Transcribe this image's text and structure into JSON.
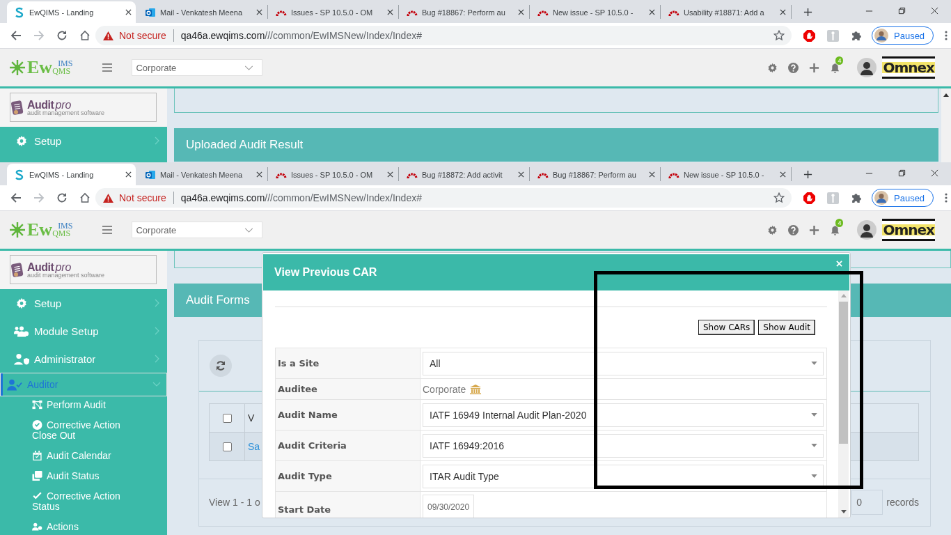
{
  "screens": [
    {
      "browser": {
        "tabs": [
          {
            "title": "EwQIMS - Landing",
            "kind": "ewqims",
            "selected": true
          },
          {
            "title": "Mail - Venkatesh Meena",
            "kind": "outlook",
            "selected": false
          },
          {
            "title": "Issues - SP 10.5.0 - OM",
            "kind": "redmine",
            "selected": false
          },
          {
            "title": "Bug #18867: Perform au",
            "kind": "redmine",
            "selected": false
          },
          {
            "title": "New issue - SP 10.5.0 -",
            "kind": "redmine",
            "selected": false
          },
          {
            "title": "Usability #18871: Add a",
            "kind": "redmine",
            "selected": false
          }
        ],
        "warning": "Not secure",
        "url_host": "qa46a.ewqims.com",
        "url_path": "///common/EwIMSNew/Index/Index#",
        "profile_status": "Paused"
      },
      "header": {
        "logo": {
          "main": "Ew",
          "top": "IMS",
          "bottom": "QMS"
        },
        "site": "Corporate",
        "notifications": "4",
        "company": "Omnex"
      },
      "sidebar": {
        "brand": {
          "name": "Audit",
          "suffix": "pro",
          "tagline": "audit management software"
        },
        "items": [
          {
            "label": "Setup",
            "selected": false,
            "expanded": false
          }
        ]
      },
      "main": {
        "heading": "Uploaded Audit Result"
      }
    },
    {
      "browser": {
        "tabs": [
          {
            "title": "EwQIMS - Landing",
            "kind": "ewqims",
            "selected": true
          },
          {
            "title": "Mail - Venkatesh Meena",
            "kind": "outlook",
            "selected": false
          },
          {
            "title": "Issues - SP 10.5.0 - OM",
            "kind": "redmine",
            "selected": false
          },
          {
            "title": "Bug #18872: Add activit",
            "kind": "redmine",
            "selected": false
          },
          {
            "title": "Bug #18867: Perform au",
            "kind": "redmine",
            "selected": false
          },
          {
            "title": "New issue - SP 10.5.0 -",
            "kind": "redmine",
            "selected": false
          }
        ],
        "warning": "Not secure",
        "url_host": "qa46a.ewqims.com",
        "url_path": "///common/EwIMSNew/Index/Index#",
        "profile_status": "Paused"
      },
      "header": {
        "logo": {
          "main": "Ew",
          "top": "IMS",
          "bottom": "QMS"
        },
        "site": "Corporate",
        "notifications": "4",
        "company": "Omnex"
      },
      "sidebar": {
        "brand": {
          "name": "Audit",
          "suffix": "pro",
          "tagline": "audit management software"
        },
        "items": [
          {
            "label": "Setup",
            "selected": false,
            "expanded": false
          },
          {
            "label": "Module Setup",
            "selected": false,
            "expanded": false
          },
          {
            "label": "Administrator",
            "selected": false,
            "expanded": false
          },
          {
            "label": "Auditor",
            "selected": true,
            "expanded": true,
            "children": [
              {
                "label": "Perform Audit"
              },
              {
                "label": "Corrective Action Close Out"
              },
              {
                "label": "Audit Calendar"
              },
              {
                "label": "Audit Status"
              },
              {
                "label": "Corrective Action Status"
              },
              {
                "label": "Actions"
              }
            ]
          }
        ]
      },
      "main": {
        "heading": "Audit Forms",
        "grid": {
          "header_checked": false,
          "column": "V",
          "rows": [
            {
              "link": "Sa",
              "checked": false
            }
          ],
          "pager": "View 1 - 1 o",
          "page_size": "0",
          "records_label": "records"
        }
      },
      "dialog": {
        "title": "View Previous CAR",
        "buttons": [
          "Show CARs",
          "Show Audit"
        ],
        "fields": [
          {
            "label": "Is a Site",
            "kind": "select",
            "value": "All"
          },
          {
            "label": "Auditee",
            "kind": "text",
            "value": "Corporate"
          },
          {
            "label": "Audit Name",
            "kind": "select",
            "value": "IATF 16949 Internal Audit Plan-2020"
          },
          {
            "label": "Audit Criteria",
            "kind": "select",
            "value": "IATF 16949:2016"
          },
          {
            "label": "Audit Type",
            "kind": "select",
            "value": "ITAR Audit Type"
          },
          {
            "label": "Start Date",
            "kind": "date",
            "value": "09/30/2020"
          }
        ]
      }
    }
  ],
  "annotation": {
    "kind": "rectangle"
  }
}
